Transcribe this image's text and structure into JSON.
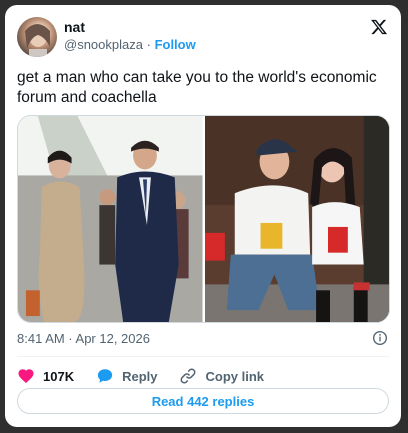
{
  "author": {
    "name": "nat",
    "handle": "@snookplaza",
    "separator": "·",
    "follow_label": "Follow"
  },
  "tweet": {
    "text": "get a man who can take you to the world's economic forum and coachella",
    "timestamp": "8:41 AM · Apr 12, 2026"
  },
  "actions": {
    "like_count": "107K",
    "reply_label": "Reply",
    "copy_link_label": "Copy link"
  },
  "read_replies_label": "Read 442 replies",
  "colors": {
    "accent": "#1d9bf0",
    "like": "#f91880",
    "text": "#0f1419",
    "muted": "#536471"
  },
  "icons": [
    "x-logo-icon",
    "info-icon",
    "heart-icon",
    "reply-bubble-icon",
    "link-icon"
  ]
}
